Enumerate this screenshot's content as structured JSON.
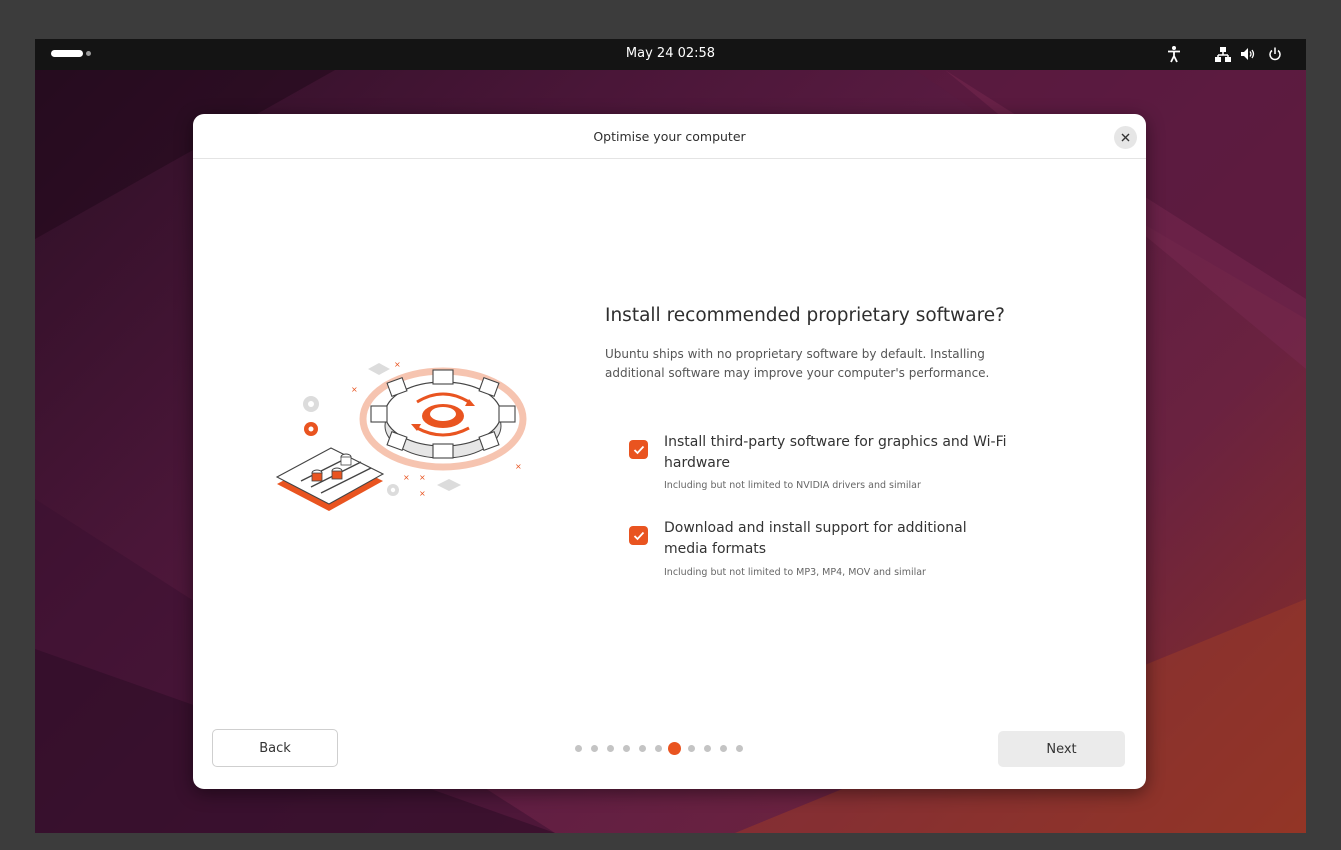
{
  "topbar": {
    "clock": "May 24  02:58"
  },
  "dialog": {
    "title": "Optimise your computer",
    "heading": "Install recommended proprietary software?",
    "description_line1": "Ubuntu ships with no proprietary software by default. Installing",
    "description_line2": "additional software may improve your computer's performance.",
    "options": [
      {
        "label_line1": "Install third-party software for graphics and Wi-Fi",
        "label_line2": "hardware",
        "sublabel": "Including but not limited to NVIDIA drivers and similar",
        "checked": true
      },
      {
        "label_line1": "Download and install support for additional",
        "label_line2": "media formats",
        "sublabel": "Including but not limited to MP3, MP4, MOV and similar",
        "checked": true
      }
    ],
    "back_label": "Back",
    "next_label": "Next",
    "progress": {
      "total": 11,
      "current": 7
    }
  },
  "colors": {
    "accent": "#e95420",
    "topbar": "#141414",
    "dialog_bg": "#ffffff"
  },
  "icons": [
    "activities-pill",
    "workspace-dot",
    "accessibility-icon",
    "network-icon",
    "volume-icon",
    "power-icon",
    "close-icon",
    "checkmark-icon"
  ]
}
